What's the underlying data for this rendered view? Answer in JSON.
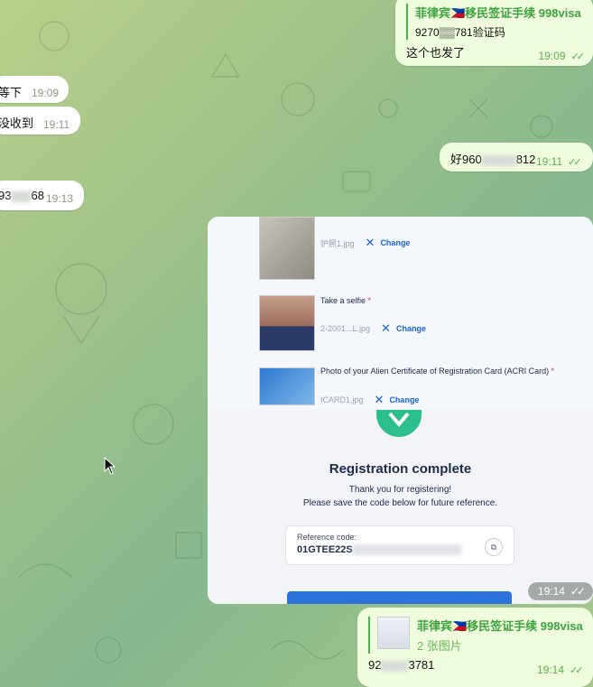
{
  "messages": {
    "out1": {
      "reply_title": "菲律宾🇵🇭移民签证手续 998visa",
      "reply_line": "9270▒▒781验证码",
      "text": "这个也发了",
      "time": "19:09"
    },
    "in1": {
      "text": "等下",
      "time": "19:09"
    },
    "in2": {
      "text": "没收到",
      "time": "19:11"
    },
    "out2": {
      "text_prefix": "好960",
      "text_suffix": "812",
      "time": "19:11"
    },
    "in3": {
      "text_prefix": "93",
      "text_suffix": "68",
      "time": "19:13"
    },
    "out3": {
      "reply_title": "菲律宾🇵🇭移民签证手续 998visa",
      "reply_sub": "2 张图片",
      "text_prefix": "92",
      "text_suffix": "3781",
      "time": "19:14"
    }
  },
  "image_card": {
    "file1": {
      "name": "护照1.jpg",
      "change": "Change"
    },
    "file2": {
      "label": "Take a selfie",
      "required": "*",
      "name": "2-2001...L.jpg",
      "change": "Change"
    },
    "file3": {
      "label": "Photo of your Alien Certificate of Registration Card (ACRI Card)",
      "required": "*",
      "name": "ICARD1.jpg",
      "change": "Change"
    },
    "title": "Registration complete",
    "subtitle1": "Thank you for registering!",
    "subtitle2": "Please save the code below for future reference.",
    "ref_label": "Reference code:",
    "ref_code": "01GTEE22S",
    "time": "19:14"
  },
  "colors": {
    "accent_green": "#4fae4e",
    "outgoing_bubble": "#effdde",
    "button_blue": "#2c73dc",
    "success_green": "#2bbf8c"
  }
}
